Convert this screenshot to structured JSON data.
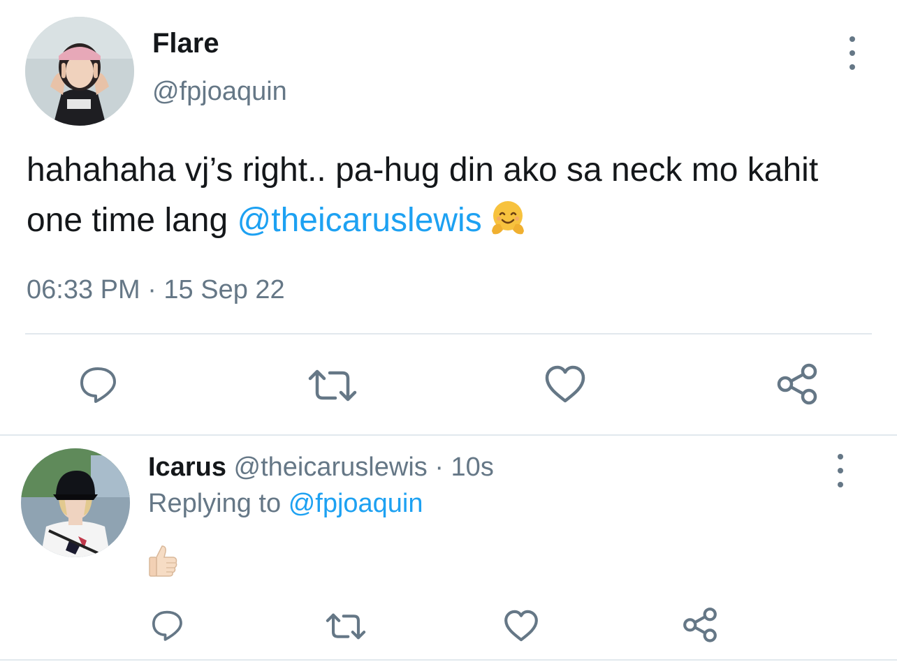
{
  "main_tweet": {
    "display_name": "Flare",
    "handle": "@fpjoaquin",
    "text_before_mention": "hahahaha vj’s right.. pa-hug din ako sa neck mo kahit one time lang",
    "mention": "@theicaruslewis",
    "emoji": "hugging-face",
    "timestamp": "06:33 PM · 15 Sep 22",
    "actions": [
      "reply-icon",
      "retweet-icon",
      "like-icon",
      "share-icon"
    ]
  },
  "reply_tweet": {
    "display_name": "Icarus",
    "handle": "@theicaruslewis",
    "separator": "·",
    "time_ago": "10s",
    "replying_label": "Replying to",
    "replying_to": "@fpjoaquin",
    "emoji": "thumbs-up",
    "actions": [
      "reply-icon",
      "retweet-icon",
      "like-icon",
      "share-icon"
    ]
  },
  "colors": {
    "link": "#1da1f2",
    "muted": "#657786",
    "text": "#14171a",
    "divider": "#e1e8ed"
  }
}
